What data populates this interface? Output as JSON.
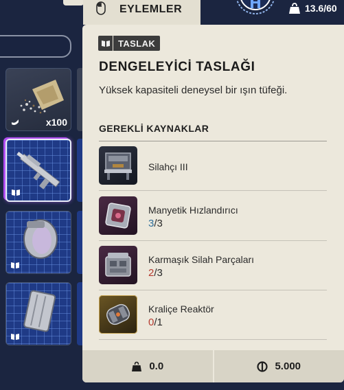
{
  "topbar": {
    "actions_label": "EYLEMLER",
    "weight_value": "13.6/60",
    "icons": [
      "mouse-icon",
      "emblem-icon",
      "weight-icon"
    ]
  },
  "inventory": {
    "slots": [
      {
        "kind": "material",
        "count": "x100",
        "icon": "stack-icon"
      },
      {
        "kind": "blueprint",
        "selected": true,
        "icon": "book-icon"
      },
      {
        "kind": "blueprint",
        "icon": "book-icon"
      },
      {
        "kind": "blueprint",
        "icon": "book-icon"
      }
    ]
  },
  "tooltip": {
    "badge": "TASLAK",
    "title": "DENGELEYİCİ TASLAĞI",
    "description": "Yüksek kapasiteli deneysel bir ışın tüfeği.",
    "requirements_title": "GEREKLİ KAYNAKLAR",
    "requirements": [
      {
        "name": "Silahçı III",
        "have": "",
        "need": "",
        "color": "#2a2a2a"
      },
      {
        "name": "Manyetik Hızlandırıcı",
        "have": "3",
        "need": "/3",
        "color": "#2f6f9a"
      },
      {
        "name": "Karmaşık Silah Parçaları",
        "have": "2",
        "need": "/3",
        "color": "#b53a2e"
      },
      {
        "name": "Kraliçe Reaktör",
        "have": "0",
        "need": "/1",
        "color": "#b53a2e"
      }
    ],
    "footer": {
      "weight": "0.0",
      "price": "5.000"
    }
  },
  "colors": {
    "panel_bg": "#ece8dc",
    "background": "#1b2540",
    "available": "#2f6f9a",
    "missing": "#b53a2e",
    "selection_glow": "#b04cf0"
  }
}
